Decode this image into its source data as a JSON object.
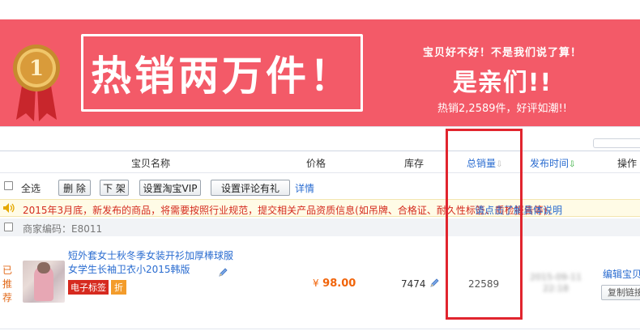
{
  "banner": {
    "medal_number": "1",
    "hero_text": "热销两万件！",
    "slogan_line1": "宝贝好不好！不是我们说了算！",
    "slogan_line2": "是亲们!!",
    "slogan_line3": "热销2,2589件，好评如潮!!"
  },
  "columns": {
    "name": "宝贝名称",
    "price": "价格",
    "stock": "库存",
    "total_sales": "总销量",
    "publish_time": "发布时间",
    "action": "操作"
  },
  "toolbar": {
    "select_all": "全选",
    "delete": "删 除",
    "delist": "下 架",
    "set_vip": "设置淘宝VIP",
    "set_review": "设置评论有礼",
    "details": "详情"
  },
  "notice": {
    "text": "2015年3月底，新发布的商品，将需要按照行业规范，提交相关产品资质信息(如吊牌、合格证、耐久性标签、质检报告等)，",
    "link": "请点击了解具体说明"
  },
  "merchant_code": "商家编码：E8011",
  "product": {
    "recommended": "已推荐",
    "title": "短外套女士秋冬季女装开衫加厚棒球服女学生长袖卫衣小2015韩版",
    "tag_label": "电子标签",
    "tag_discount": "折",
    "currency": "¥",
    "price": "98.00",
    "stock": "7474",
    "sales": "22589",
    "publish_time_blurred": "2015-09-11 22:18",
    "edit_link": "编辑宝贝",
    "copy_link": "复制链接"
  },
  "colors": {
    "banner_bg": "#f35a68",
    "link": "#2a6cd0",
    "price": "#f1640a",
    "highlight": "#e1252e",
    "notice_text": "#d42b1e"
  }
}
